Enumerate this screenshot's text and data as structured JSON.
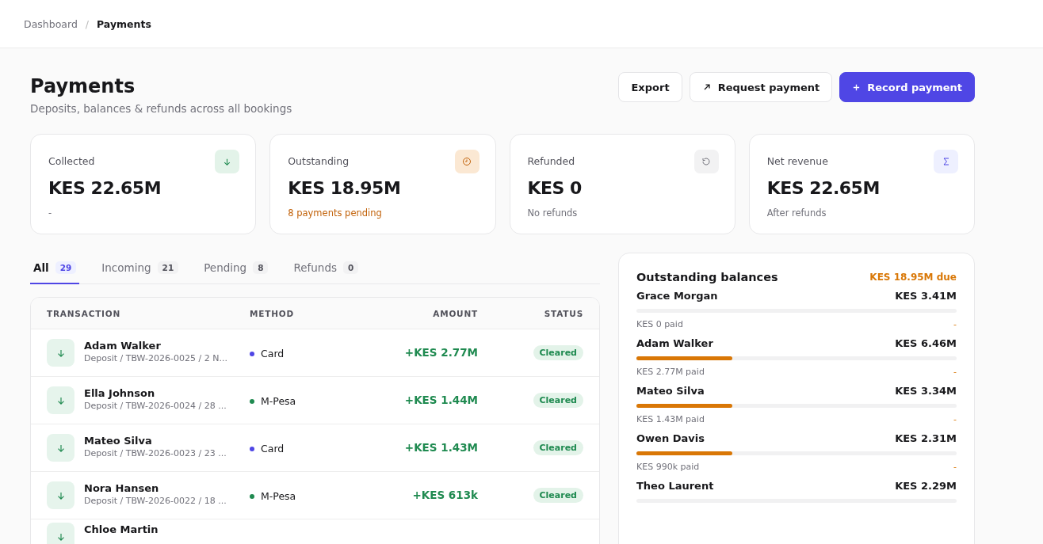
{
  "breadcrumb": [
    {
      "label": "Dashboard",
      "selected": false
    },
    {
      "separator": "/",
      "label": "Payments",
      "selected": true
    }
  ],
  "header": {
    "title": "Payments",
    "subtitle": "Deposits, balances & refunds across all bookings"
  },
  "actions": [
    {
      "label": "Export",
      "kind": "plain"
    },
    {
      "label": "Request payment",
      "kind": "request"
    },
    {
      "label": "Record payment",
      "kind": "primary"
    }
  ],
  "stats": [
    {
      "label": "Collected",
      "value": "KES 22.65M",
      "note": "-",
      "kind": "collected"
    },
    {
      "label": "Outstanding",
      "value": "KES 18.95M",
      "note": "8 payments pending",
      "kind": "outstanding"
    },
    {
      "label": "Refunded",
      "value": "KES 0",
      "note": "No refunds",
      "kind": "refunded"
    },
    {
      "label": "Net revenue",
      "value": "KES 22.65M",
      "note": "After refunds",
      "kind": "net"
    }
  ],
  "tabs": [
    {
      "label": "All",
      "count": "29",
      "selected": true
    },
    {
      "label": "Incoming",
      "count": "21",
      "selected": false
    },
    {
      "label": "Pending",
      "count": "8",
      "selected": false
    },
    {
      "label": "Refunds",
      "count": "0",
      "selected": false
    }
  ],
  "table": {
    "columns": [
      "TRANSACTION",
      "METHOD",
      "AMOUNT",
      "STATUS"
    ],
    "rows": [
      {
        "name": "Adam Walker",
        "detail": "Deposit / TBW-2026-0025 / 2 N...",
        "method": "Card",
        "color": "#4f46e5",
        "amount": "+KES 2.77M",
        "status": "Cleared"
      },
      {
        "name": "Ella Johnson",
        "detail": "Deposit / TBW-2026-0024 / 28 ...",
        "method": "M-Pesa",
        "color": "#1f8a50",
        "amount": "+KES 1.44M",
        "status": "Cleared"
      },
      {
        "name": "Mateo Silva",
        "detail": "Deposit / TBW-2026-0023 / 23 ...",
        "method": "Card",
        "color": "#4f46e5",
        "amount": "+KES 1.43M",
        "status": "Cleared"
      },
      {
        "name": "Nora Hansen",
        "detail": "Deposit / TBW-2026-0022 / 18 ...",
        "method": "M-Pesa",
        "color": "#1f8a50",
        "amount": "+KES 613k",
        "status": "Cleared"
      },
      {
        "name": "Chloe Martin"
      }
    ]
  },
  "balances": {
    "title": "Outstanding balances",
    "total": "KES 18.95M due",
    "items": [
      {
        "name": "Grace Morgan",
        "amount": "KES 3.41M",
        "paid": "KES 0 paid",
        "trail": "-"
      },
      {
        "name": "Adam Walker",
        "amount": "KES 6.46M",
        "level": 0.3,
        "paid": "KES 2.77M paid",
        "trail": "-"
      },
      {
        "name": "Mateo Silva",
        "amount": "KES 3.34M",
        "level": 0.3,
        "paid": "KES 1.43M paid",
        "trail": "-"
      },
      {
        "name": "Owen Davis",
        "amount": "KES 2.31M",
        "level": 0.3,
        "paid": "KES 990k paid",
        "trail": "-"
      },
      {
        "name": "Theo Laurent",
        "amount": "KES 2.29M"
      }
    ]
  }
}
